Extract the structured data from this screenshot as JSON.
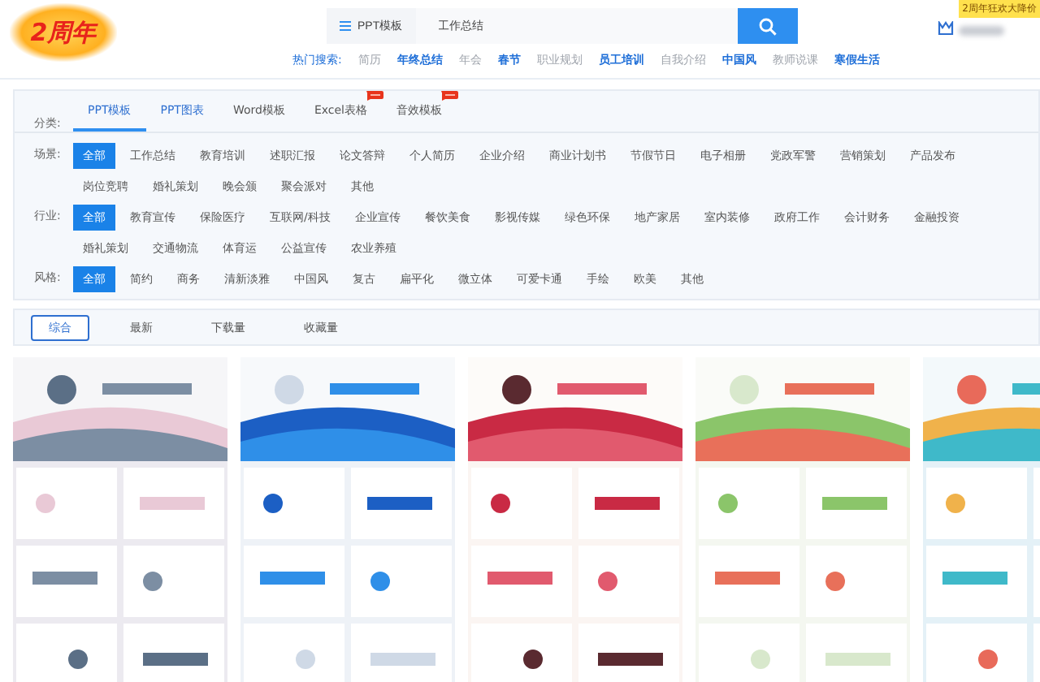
{
  "header": {
    "logo": "2周年",
    "search": {
      "scope": "PPT模板",
      "value": "工作总结"
    },
    "promo_badge": "2周年狂欢大降价"
  },
  "hot_search": {
    "label": "热门搜索:",
    "items": [
      {
        "text": "简历",
        "highlighted": false
      },
      {
        "text": "年终总结",
        "highlighted": true
      },
      {
        "text": "年会",
        "highlighted": false
      },
      {
        "text": "春节",
        "highlighted": true
      },
      {
        "text": "职业规划",
        "highlighted": false
      },
      {
        "text": "员工培训",
        "highlighted": true
      },
      {
        "text": "自我介绍",
        "highlighted": false
      },
      {
        "text": "中国风",
        "highlighted": true
      },
      {
        "text": "教师说课",
        "highlighted": false
      },
      {
        "text": "寒假生活",
        "highlighted": true
      }
    ]
  },
  "categories": {
    "label": "分类:",
    "tabs": [
      {
        "label": "PPT模板",
        "selected": true,
        "highlighted": true,
        "new": false
      },
      {
        "label": "PPT图表",
        "selected": false,
        "highlighted": true,
        "new": false
      },
      {
        "label": "Word模板",
        "selected": false,
        "highlighted": false,
        "new": false
      },
      {
        "label": "Excel表格",
        "selected": false,
        "highlighted": false,
        "new": true
      },
      {
        "label": "音效模板",
        "selected": false,
        "highlighted": false,
        "new": true
      }
    ]
  },
  "filters": [
    {
      "label": "场景:",
      "options": [
        {
          "text": "全部",
          "selected": true
        },
        {
          "text": "工作总结",
          "selected": false
        },
        {
          "text": "教育培训",
          "selected": false
        },
        {
          "text": "述职汇报",
          "selected": false
        },
        {
          "text": "论文答辩",
          "selected": false
        },
        {
          "text": "个人简历",
          "selected": false
        },
        {
          "text": "企业介绍",
          "selected": false
        },
        {
          "text": "商业计划书",
          "selected": false
        },
        {
          "text": "节假节日",
          "selected": false
        },
        {
          "text": "电子相册",
          "selected": false
        },
        {
          "text": "党政军警",
          "selected": false
        },
        {
          "text": "营销策划",
          "selected": false
        },
        {
          "text": "产品发布",
          "selected": false
        },
        {
          "text": "岗位竞聘",
          "selected": false
        },
        {
          "text": "婚礼策划",
          "selected": false
        },
        {
          "text": "晚会颁",
          "selected": false
        },
        {
          "text": "聚会派对",
          "selected": false
        },
        {
          "text": "其他",
          "selected": false
        }
      ]
    },
    {
      "label": "行业:",
      "options": [
        {
          "text": "全部",
          "selected": true
        },
        {
          "text": "教育宣传",
          "selected": false
        },
        {
          "text": "保险医疗",
          "selected": false
        },
        {
          "text": "互联网/科技",
          "selected": false
        },
        {
          "text": "企业宣传",
          "selected": false
        },
        {
          "text": "餐饮美食",
          "selected": false
        },
        {
          "text": "影视传媒",
          "selected": false
        },
        {
          "text": "绿色环保",
          "selected": false
        },
        {
          "text": "地产家居",
          "selected": false
        },
        {
          "text": "室内装修",
          "selected": false
        },
        {
          "text": "政府工作",
          "selected": false
        },
        {
          "text": "会计财务",
          "selected": false
        },
        {
          "text": "金融投资",
          "selected": false
        },
        {
          "text": "婚礼策划",
          "selected": false
        },
        {
          "text": "交通物流",
          "selected": false
        },
        {
          "text": "体育运",
          "selected": false
        },
        {
          "text": "公益宣传",
          "selected": false
        },
        {
          "text": "农业养殖",
          "selected": false
        }
      ]
    },
    {
      "label": "风格:",
      "options": [
        {
          "text": "全部",
          "selected": true
        },
        {
          "text": "简约",
          "selected": false
        },
        {
          "text": "商务",
          "selected": false
        },
        {
          "text": "清新淡雅",
          "selected": false
        },
        {
          "text": "中国风",
          "selected": false
        },
        {
          "text": "复古",
          "selected": false
        },
        {
          "text": "扁平化",
          "selected": false
        },
        {
          "text": "微立体",
          "selected": false
        },
        {
          "text": "可爱卡通",
          "selected": false
        },
        {
          "text": "手绘",
          "selected": false
        },
        {
          "text": "欧美",
          "selected": false
        },
        {
          "text": "其他",
          "selected": false
        }
      ]
    }
  ],
  "sort": [
    {
      "label": "综合",
      "selected": true
    },
    {
      "label": "最新",
      "selected": false
    },
    {
      "label": "下载量",
      "selected": false
    },
    {
      "label": "收藏量",
      "selected": false
    }
  ]
}
